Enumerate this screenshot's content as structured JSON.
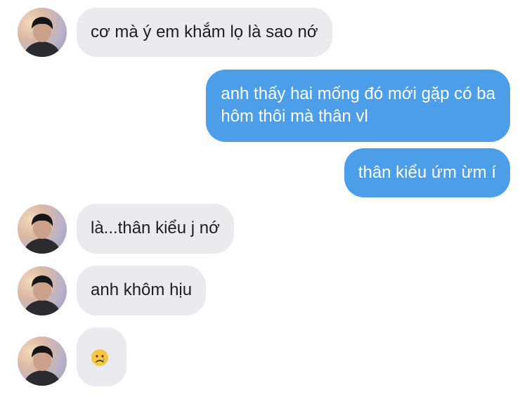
{
  "messages": [
    {
      "side": "in",
      "text": "cơ mà ý em khắm lọ là sao nớ"
    },
    {
      "side": "out",
      "text": "anh thấy hai mống đó mới gặp có ba hôm thôi mà thân vl",
      "lines": [
        "anh thấy hai mống đó mới gặp có ba",
        "hôm thôi mà thân vl"
      ]
    },
    {
      "side": "out",
      "text": "thân kiểu ứm ừm í"
    },
    {
      "side": "in",
      "text": "là...thân kiểu j nớ"
    },
    {
      "side": "in",
      "text": "anh khôm hịu"
    },
    {
      "side": "in",
      "text": "",
      "emoji": "crying-face-emoji"
    }
  ],
  "colors": {
    "incoming_bubble": "#e9ebef",
    "outgoing_bubble": "#4c9ee8",
    "incoming_text": "#1c1e21",
    "outgoing_text": "#ffffff"
  },
  "icons": {
    "avatar": "profile-photo",
    "emoji": "crying-face-emoji"
  }
}
